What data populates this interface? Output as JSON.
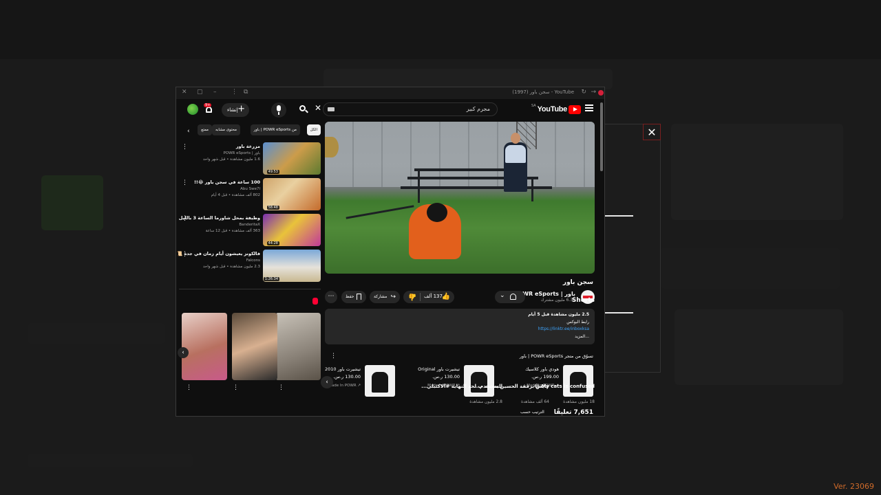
{
  "window": {
    "title": "YouTube - سجن باور (1997)",
    "version": "Ver. 23069"
  },
  "header": {
    "logo_text": "YouTube",
    "country_code": "SA",
    "search_value": "مجرم كبير",
    "create_label": "إنشاء",
    "notification_count": "9+"
  },
  "video": {
    "title": "سجن باور",
    "channel_name": "باور | POWR eSports",
    "subscribers": "6.35 مليون مشترك",
    "likes": "137 ألف",
    "share_label": "مشاركة",
    "save_label": "حفظ",
    "description": {
      "stats": "2.5 مليون مشاهدة  قبل 5 أيام",
      "line2": "رابط البوكس",
      "link": "https://linktr.ee/inboxksa",
      "more": "...المزيد"
    }
  },
  "store": {
    "heading": "تسوّق من متجر POWR eSports | باور",
    "products": [
      {
        "name": "هودي باور كلاسيك",
        "price": "199.00 ر.س.",
        "store": "Made In POWR ↗"
      },
      {
        "name": "تيشيرت باور Original",
        "price": "130.00 ر.س.",
        "store": "Made In POWR ↗"
      },
      {
        "name": "تيشيرت باور 2010",
        "price": "130.00 ر.س.",
        "store": "Made In POWR ↗"
      }
    ]
  },
  "comments": {
    "count_label": "7,651 تعليقًا",
    "sort_label": "الترتيب حسب"
  },
  "chips": [
    "الكل",
    "من POWR eSports | باور",
    "محتوى مشابه",
    "ممتع"
  ],
  "recommendations": [
    {
      "title": "مزرعة باور",
      "channel": "باور | POWR eSports",
      "meta": "1.6 مليون مشاهدة • قبل شهر واحد",
      "duration": "49:53"
    },
    {
      "title": "100 ساعة في سجن باور 😂!!",
      "channel": "Abu Swe7l",
      "meta": "802 ألف مشاهدة • قبل 4 أيام",
      "duration": "58:48"
    },
    {
      "title": "وظيفة بمحل شاورما الساعة 3 بالليل",
      "channel": "BanderitaX",
      "meta": "363 ألف مشاهدة • قبل 12 ساعة",
      "duration": "44:28"
    },
    {
      "title": "فالكونز يعيشون أيام زمان في جدة 📜",
      "channel": "Falcons",
      "meta": "2.3 مليون مشاهدة • قبل شهر واحد",
      "duration": "1:26:34"
    }
  ],
  "shorts": {
    "heading": "Shorts",
    "items": [
      {
        "title": "My cats is confused 😂",
        "views": "18 مليون مشاهدة"
      },
      {
        "title": "عايض برفقة الحسين يستخدم...",
        "views": "64 ألف مشاهدة"
      },
      {
        "title": "السحمه ب لحد النهاية #الاكتبلي...",
        "views": "2.8 مليون مشاهدة"
      }
    ]
  }
}
